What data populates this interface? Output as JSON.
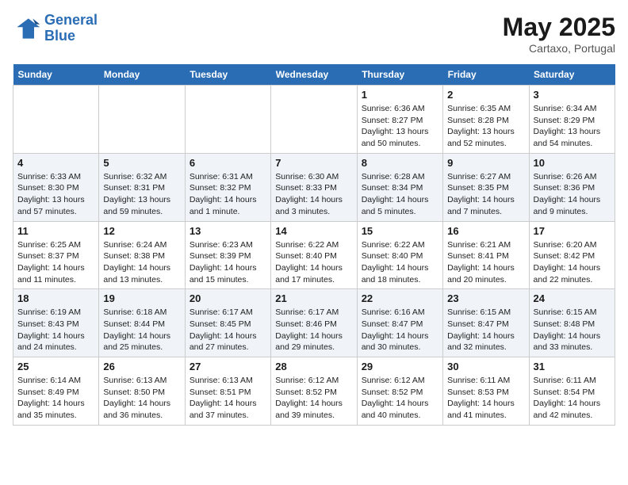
{
  "header": {
    "logo_line1": "General",
    "logo_line2": "Blue",
    "month": "May 2025",
    "location": "Cartaxo, Portugal"
  },
  "weekdays": [
    "Sunday",
    "Monday",
    "Tuesday",
    "Wednesday",
    "Thursday",
    "Friday",
    "Saturday"
  ],
  "weeks": [
    [
      {
        "day": "",
        "info": ""
      },
      {
        "day": "",
        "info": ""
      },
      {
        "day": "",
        "info": ""
      },
      {
        "day": "",
        "info": ""
      },
      {
        "day": "1",
        "info": "Sunrise: 6:36 AM\nSunset: 8:27 PM\nDaylight: 13 hours\nand 50 minutes."
      },
      {
        "day": "2",
        "info": "Sunrise: 6:35 AM\nSunset: 8:28 PM\nDaylight: 13 hours\nand 52 minutes."
      },
      {
        "day": "3",
        "info": "Sunrise: 6:34 AM\nSunset: 8:29 PM\nDaylight: 13 hours\nand 54 minutes."
      }
    ],
    [
      {
        "day": "4",
        "info": "Sunrise: 6:33 AM\nSunset: 8:30 PM\nDaylight: 13 hours\nand 57 minutes."
      },
      {
        "day": "5",
        "info": "Sunrise: 6:32 AM\nSunset: 8:31 PM\nDaylight: 13 hours\nand 59 minutes."
      },
      {
        "day": "6",
        "info": "Sunrise: 6:31 AM\nSunset: 8:32 PM\nDaylight: 14 hours\nand 1 minute."
      },
      {
        "day": "7",
        "info": "Sunrise: 6:30 AM\nSunset: 8:33 PM\nDaylight: 14 hours\nand 3 minutes."
      },
      {
        "day": "8",
        "info": "Sunrise: 6:28 AM\nSunset: 8:34 PM\nDaylight: 14 hours\nand 5 minutes."
      },
      {
        "day": "9",
        "info": "Sunrise: 6:27 AM\nSunset: 8:35 PM\nDaylight: 14 hours\nand 7 minutes."
      },
      {
        "day": "10",
        "info": "Sunrise: 6:26 AM\nSunset: 8:36 PM\nDaylight: 14 hours\nand 9 minutes."
      }
    ],
    [
      {
        "day": "11",
        "info": "Sunrise: 6:25 AM\nSunset: 8:37 PM\nDaylight: 14 hours\nand 11 minutes."
      },
      {
        "day": "12",
        "info": "Sunrise: 6:24 AM\nSunset: 8:38 PM\nDaylight: 14 hours\nand 13 minutes."
      },
      {
        "day": "13",
        "info": "Sunrise: 6:23 AM\nSunset: 8:39 PM\nDaylight: 14 hours\nand 15 minutes."
      },
      {
        "day": "14",
        "info": "Sunrise: 6:22 AM\nSunset: 8:40 PM\nDaylight: 14 hours\nand 17 minutes."
      },
      {
        "day": "15",
        "info": "Sunrise: 6:22 AM\nSunset: 8:40 PM\nDaylight: 14 hours\nand 18 minutes."
      },
      {
        "day": "16",
        "info": "Sunrise: 6:21 AM\nSunset: 8:41 PM\nDaylight: 14 hours\nand 20 minutes."
      },
      {
        "day": "17",
        "info": "Sunrise: 6:20 AM\nSunset: 8:42 PM\nDaylight: 14 hours\nand 22 minutes."
      }
    ],
    [
      {
        "day": "18",
        "info": "Sunrise: 6:19 AM\nSunset: 8:43 PM\nDaylight: 14 hours\nand 24 minutes."
      },
      {
        "day": "19",
        "info": "Sunrise: 6:18 AM\nSunset: 8:44 PM\nDaylight: 14 hours\nand 25 minutes."
      },
      {
        "day": "20",
        "info": "Sunrise: 6:17 AM\nSunset: 8:45 PM\nDaylight: 14 hours\nand 27 minutes."
      },
      {
        "day": "21",
        "info": "Sunrise: 6:17 AM\nSunset: 8:46 PM\nDaylight: 14 hours\nand 29 minutes."
      },
      {
        "day": "22",
        "info": "Sunrise: 6:16 AM\nSunset: 8:47 PM\nDaylight: 14 hours\nand 30 minutes."
      },
      {
        "day": "23",
        "info": "Sunrise: 6:15 AM\nSunset: 8:47 PM\nDaylight: 14 hours\nand 32 minutes."
      },
      {
        "day": "24",
        "info": "Sunrise: 6:15 AM\nSunset: 8:48 PM\nDaylight: 14 hours\nand 33 minutes."
      }
    ],
    [
      {
        "day": "25",
        "info": "Sunrise: 6:14 AM\nSunset: 8:49 PM\nDaylight: 14 hours\nand 35 minutes."
      },
      {
        "day": "26",
        "info": "Sunrise: 6:13 AM\nSunset: 8:50 PM\nDaylight: 14 hours\nand 36 minutes."
      },
      {
        "day": "27",
        "info": "Sunrise: 6:13 AM\nSunset: 8:51 PM\nDaylight: 14 hours\nand 37 minutes."
      },
      {
        "day": "28",
        "info": "Sunrise: 6:12 AM\nSunset: 8:52 PM\nDaylight: 14 hours\nand 39 minutes."
      },
      {
        "day": "29",
        "info": "Sunrise: 6:12 AM\nSunset: 8:52 PM\nDaylight: 14 hours\nand 40 minutes."
      },
      {
        "day": "30",
        "info": "Sunrise: 6:11 AM\nSunset: 8:53 PM\nDaylight: 14 hours\nand 41 minutes."
      },
      {
        "day": "31",
        "info": "Sunrise: 6:11 AM\nSunset: 8:54 PM\nDaylight: 14 hours\nand 42 minutes."
      }
    ]
  ]
}
